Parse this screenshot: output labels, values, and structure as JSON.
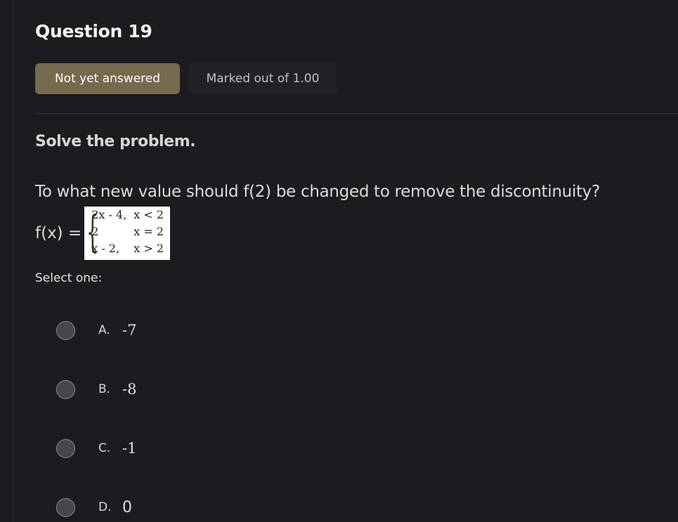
{
  "question": {
    "title": "Question 19",
    "status": "Not yet answered",
    "marks": "Marked out of 1.00",
    "instruction": "Solve the problem.",
    "text": "To what new value should f(2) be changed to remove the discontinuity?",
    "function_label": "f(x) =",
    "piecewise": [
      {
        "expr": "2x - 4,",
        "cond": "x < 2"
      },
      {
        "expr": "2",
        "cond": "x = 2"
      },
      {
        "expr": "x - 2,",
        "cond": "x > 2"
      }
    ],
    "select_label": "Select one:",
    "options": [
      {
        "letter": "A.",
        "value": "-7",
        "selected": false
      },
      {
        "letter": "B.",
        "value": "-8",
        "selected": false
      },
      {
        "letter": "C.",
        "value": "-1",
        "selected": false
      },
      {
        "letter": "D.",
        "value": "0",
        "selected": false
      }
    ]
  },
  "colors": {
    "background": "#1b1c20",
    "status_badge": "#756a4d",
    "marks_badge": "#202226"
  }
}
